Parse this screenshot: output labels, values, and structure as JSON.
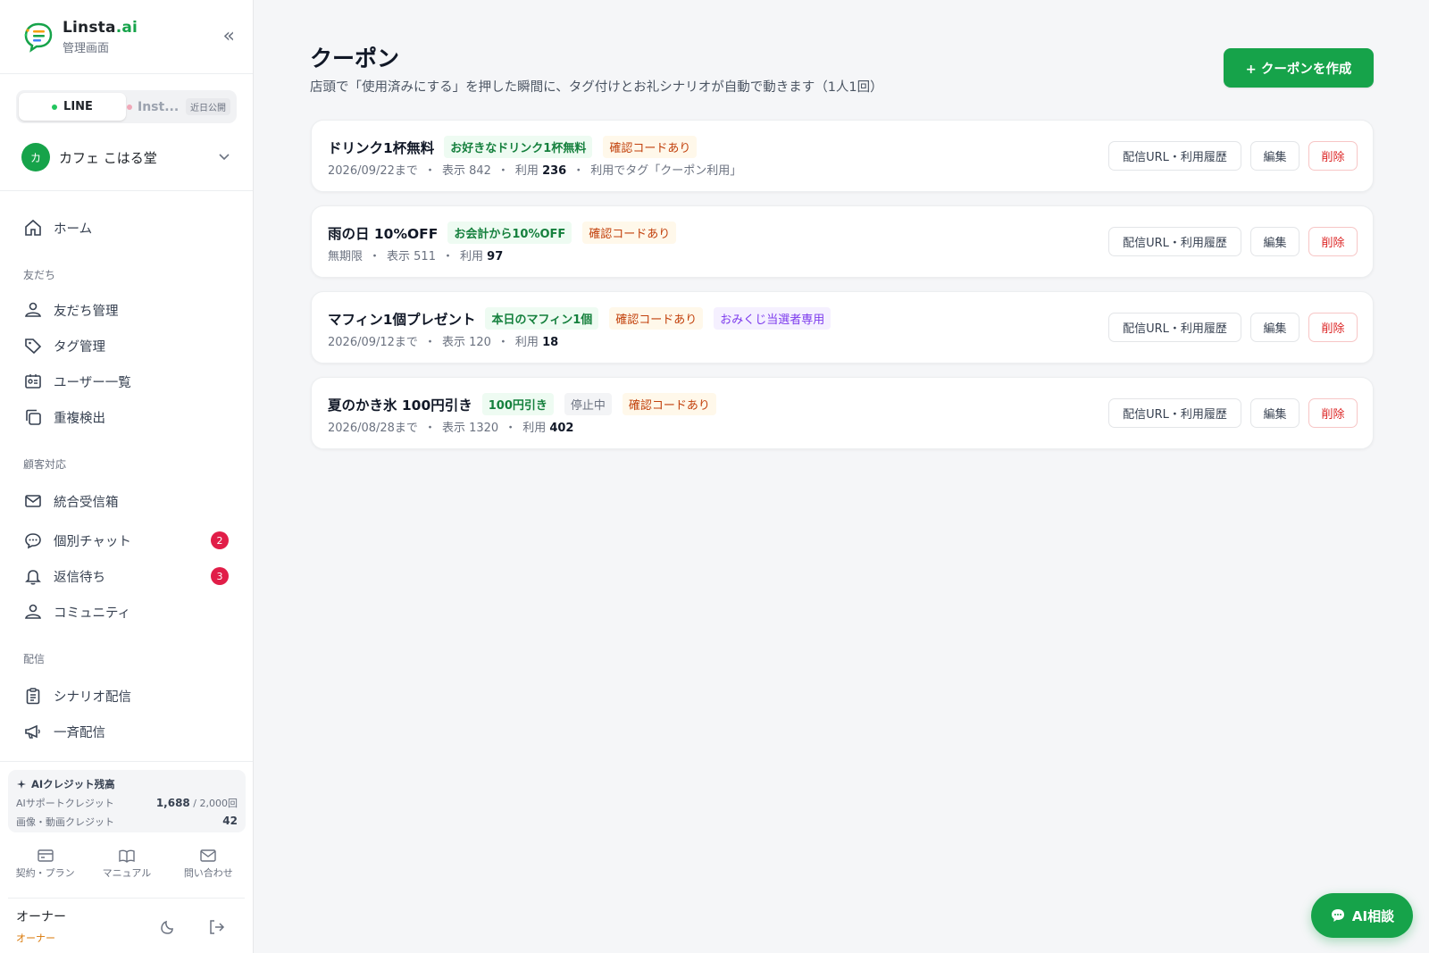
{
  "brand": {
    "name_main": "Linsta",
    "name_ai": ".ai",
    "subtitle": "管理画面"
  },
  "channel": {
    "line_label": "LINE",
    "inst_label": "Inst...",
    "soon_label": "近日公開"
  },
  "shop": {
    "avatar": "カ",
    "name": "カフェ こはる堂"
  },
  "nav": {
    "home": "ホーム",
    "section_friends": "友だち",
    "friends_manage": "友だち管理",
    "tag_manage": "タグ管理",
    "user_list": "ユーザー一覧",
    "duplicates": "重複検出",
    "section_support": "顧客対応",
    "inbox": "統合受信箱",
    "chat": "個別チャット",
    "chat_badge": "2",
    "waiting": "返信待ち",
    "waiting_badge": "3",
    "community": "コミュニティ",
    "section_delivery": "配信",
    "scenario": "シナリオ配信",
    "broadcast": "一斉配信"
  },
  "credits": {
    "title": "AIクレジット残高",
    "support_label": "AIサポートクレジット",
    "support_value": "1,688",
    "support_total": "/ 2,000回",
    "media_label": "画像・動画クレジット",
    "media_value": "42"
  },
  "footer": {
    "plan": "契約・プラン",
    "manual": "マニュアル",
    "contact": "問い合わせ"
  },
  "user": {
    "name": "オーナー",
    "role": "オーナー"
  },
  "page": {
    "title": "クーポン",
    "subtitle": "店頭で「使用済みにする」を押した瞬間に、タグ付けとお礼シナリオが自動で動きます（1人1回）",
    "create_button": "+ クーポンを作成"
  },
  "card_actions": {
    "url": "配信URL・利用履歴",
    "edit": "編集",
    "delete": "削除"
  },
  "coupons": [
    {
      "title": "ドリンク1杯無料",
      "tags": [
        {
          "text": "お好きなドリンク1杯無料",
          "color": "green"
        },
        {
          "text": "確認コードあり",
          "color": "orange"
        }
      ],
      "expiry": "2026/09/22まで",
      "views_label": "表示 842",
      "uses_label": "利用",
      "uses": "236",
      "extra": "利用でタグ「クーポン利用」"
    },
    {
      "title": "雨の日 10%OFF",
      "tags": [
        {
          "text": "お会計から10%OFF",
          "color": "green"
        },
        {
          "text": "確認コードあり",
          "color": "orange"
        }
      ],
      "expiry": "無期限",
      "views_label": "表示 511",
      "uses_label": "利用",
      "uses": "97",
      "extra": ""
    },
    {
      "title": "マフィン1個プレゼント",
      "tags": [
        {
          "text": "本日のマフィン1個",
          "color": "green"
        },
        {
          "text": "確認コードあり",
          "color": "orange"
        },
        {
          "text": "おみくじ当選者専用",
          "color": "purple"
        }
      ],
      "expiry": "2026/09/12まで",
      "views_label": "表示 120",
      "uses_label": "利用",
      "uses": "18",
      "extra": ""
    },
    {
      "title": "夏のかき氷 100円引き",
      "tags": [
        {
          "text": "100円引き",
          "color": "green"
        },
        {
          "text": "停止中",
          "color": "gray"
        },
        {
          "text": "確認コードあり",
          "color": "orange"
        }
      ],
      "expiry": "2026/08/28まで",
      "views_label": "表示 1320",
      "uses_label": "利用",
      "uses": "402",
      "extra": ""
    }
  ],
  "ai_button": "AI相談",
  "colors": {
    "accent": "#16a34a",
    "danger": "#dc2626",
    "badge": "#e11d48"
  }
}
